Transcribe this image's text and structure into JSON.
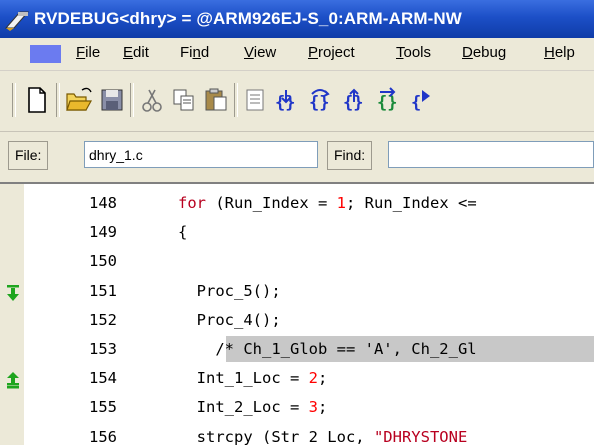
{
  "window": {
    "title": "RVDEBUG<dhry> = @ARM926EJ-S_0:ARM-ARM-NW"
  },
  "menu": {
    "items": [
      {
        "label": "File",
        "ul": "F",
        "rest": "ile"
      },
      {
        "label": "Edit",
        "ul": "E",
        "rest": "dit"
      },
      {
        "label": "Find",
        "pre": "Fi",
        "ul": "n",
        "rest": "d"
      },
      {
        "label": "View",
        "ul": "V",
        "rest": "iew"
      },
      {
        "label": "Project",
        "ul": "P",
        "rest": "roject"
      },
      {
        "label": "Tools",
        "ul": "T",
        "rest": "ools"
      },
      {
        "label": "Debug",
        "ul": "D",
        "rest": "ebug"
      },
      {
        "label": "Help",
        "ul": "H",
        "rest": "elp"
      }
    ]
  },
  "toolbar": {
    "icons": [
      "new-file-icon",
      "open-folder-icon",
      "save-icon",
      "cut-icon",
      "copy-icon",
      "paste-icon",
      "breakpoint-list-icon",
      "step-into-icon",
      "step-over-icon",
      "step-out-icon",
      "step-return-icon",
      "run-icon"
    ]
  },
  "findbar": {
    "file_label": "File:",
    "file_value": "dhry_1.c",
    "find_label": "Find:",
    "find_value": ""
  },
  "colors": {
    "keyword": "#b8001f",
    "number": "#ff0000",
    "breakpoint": "#1ea51e",
    "highlight": "#c8c8c8"
  },
  "code": {
    "lines": [
      {
        "num": "148",
        "parts": [
          {
            "t": "for",
            "c": "kw"
          },
          {
            "t": " (Run_Index = ",
            "c": ""
          },
          {
            "t": "1",
            "c": "num"
          },
          {
            "t": "; Run_Index <=",
            "c": ""
          }
        ]
      },
      {
        "num": "149",
        "parts": [
          {
            "t": "{",
            "c": ""
          }
        ]
      },
      {
        "num": "150",
        "parts": []
      },
      {
        "num": "151",
        "parts": [
          {
            "t": "  Proc_5();",
            "c": ""
          }
        ],
        "marker": "step-arrow-icon"
      },
      {
        "num": "152",
        "parts": [
          {
            "t": "  Proc_4();",
            "c": ""
          }
        ]
      },
      {
        "num": "153",
        "parts": [
          {
            "t": "    /* Ch_1_Glob == 'A', Ch_2_Gl",
            "c": ""
          }
        ],
        "highlight": true
      },
      {
        "num": "154",
        "parts": [
          {
            "t": "  Int_1_Loc = ",
            "c": ""
          },
          {
            "t": "2",
            "c": "num"
          },
          {
            "t": ";",
            "c": ""
          }
        ],
        "marker": "breakpoint-arrow-icon"
      },
      {
        "num": "155",
        "parts": [
          {
            "t": "  Int_2_Loc = ",
            "c": ""
          },
          {
            "t": "3",
            "c": "num"
          },
          {
            "t": ";",
            "c": ""
          }
        ]
      },
      {
        "num": "156",
        "parts": [
          {
            "t": "  strcpy (Str_2_Loc, ",
            "c": ""
          },
          {
            "t": "\"DHRYSTONE",
            "c": "str"
          }
        ]
      }
    ]
  }
}
